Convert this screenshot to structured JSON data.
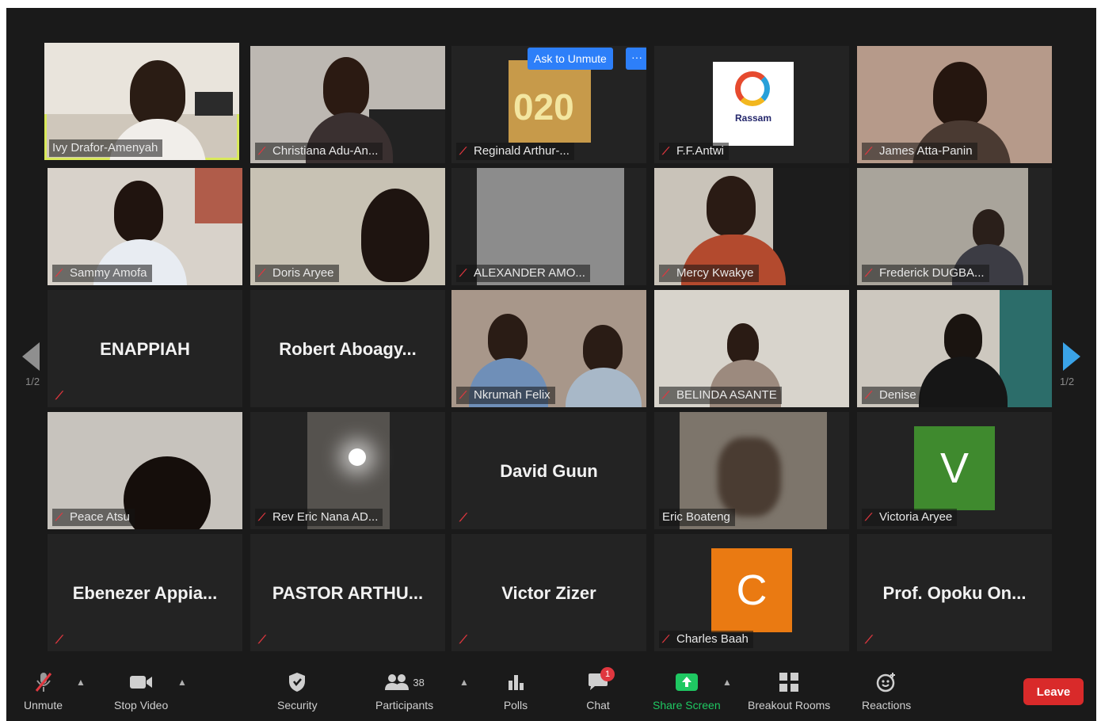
{
  "meeting": {
    "page_indicator": "1/2",
    "ask_to_unmute": "Ask to Unmute",
    "more_button": "···"
  },
  "tiles": [
    {
      "name": "Ivy Drafor-Amenyah"
    },
    {
      "name": "Christiana Adu-An..."
    },
    {
      "name": "Reginald Arthur-..."
    },
    {
      "name": "F.F.Antwi",
      "logo_text": "Rassam"
    },
    {
      "name": "James Atta-Panin"
    },
    {
      "name": "Sammy Amofa"
    },
    {
      "name": "Doris Aryee"
    },
    {
      "name": "ALEXANDER AMO..."
    },
    {
      "name": "Mercy Kwakye"
    },
    {
      "name": "Frederick DUGBA..."
    },
    {
      "name": "ENAPPIAH"
    },
    {
      "name": "Robert Aboagy..."
    },
    {
      "name": "Nkrumah Felix"
    },
    {
      "name": "BELINDA ASANTE"
    },
    {
      "name": "Denise"
    },
    {
      "name": "Peace Atsu"
    },
    {
      "name": "Rev Eric Nana AD..."
    },
    {
      "name": "David Guun"
    },
    {
      "name": "Eric Boateng"
    },
    {
      "name": "Victoria Aryee",
      "avatar_letter": "V",
      "avatar_color": "#3f8a2e"
    },
    {
      "name": "Ebenezer Appia..."
    },
    {
      "name": "PASTOR ARTHU..."
    },
    {
      "name": "Victor Zizer"
    },
    {
      "name": "Charles Baah",
      "avatar_letter": "C",
      "avatar_color": "#ea7a12"
    },
    {
      "name": "Prof. Opoku On..."
    }
  ],
  "toolbar": {
    "unmute": "Unmute",
    "stop_video": "Stop Video",
    "security": "Security",
    "participants": "Participants",
    "participants_count": "38",
    "polls": "Polls",
    "chat": "Chat",
    "chat_badge": "1",
    "share_screen": "Share Screen",
    "breakout_rooms": "Breakout Rooms",
    "reactions": "Reactions",
    "leave": "Leave"
  },
  "colors": {
    "active_speaker": "#d9e95b",
    "share_screen": "#1fc862",
    "leave": "#d92a2a",
    "ask_to_unmute": "#2d7ff9",
    "muted_mic": "#e0373f"
  },
  "icons": {
    "unmute": "muted-microphone-icon",
    "stop_video": "video-camera-icon",
    "security": "shield-icon",
    "participants": "people-icon",
    "polls": "bar-chart-icon",
    "chat": "chat-bubble-icon",
    "share_screen": "share-arrow-icon",
    "breakout_rooms": "grid-icon",
    "reactions": "smiley-icon"
  }
}
